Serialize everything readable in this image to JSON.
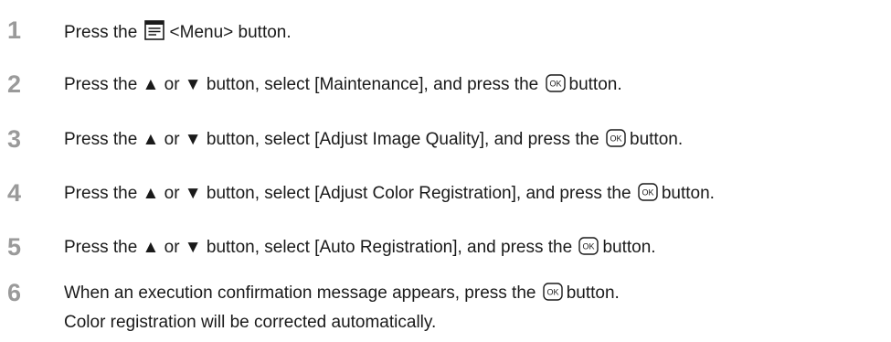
{
  "steps": [
    {
      "number": "1",
      "before": "Press the",
      "icon": "menu-icon",
      "after": "<Menu> button."
    },
    {
      "number": "2",
      "before": "Press the ▲ or ▼ button, select [Maintenance], and press the",
      "icon": "ok-icon",
      "after": "button."
    },
    {
      "number": "3",
      "before": "Press the ▲ or ▼ button, select [Adjust Image Quality], and press the",
      "icon": "ok-icon",
      "after": "button."
    },
    {
      "number": "4",
      "before": "Press the ▲ or ▼ button, select [Adjust Color Registration], and press the",
      "icon": "ok-icon",
      "after": "button."
    },
    {
      "number": "5",
      "before": "Press the ▲ or ▼ button, select [Auto Registration], and press the",
      "icon": "ok-icon",
      "after": "button."
    },
    {
      "number": "6",
      "before": "When an execution confirmation message appears, press the",
      "icon": "ok-icon",
      "after": "button."
    }
  ],
  "result_note": "Color registration will be corrected automatically.",
  "colors": {
    "step_number": "#9a9a9a",
    "text": "#1a1a1a"
  }
}
